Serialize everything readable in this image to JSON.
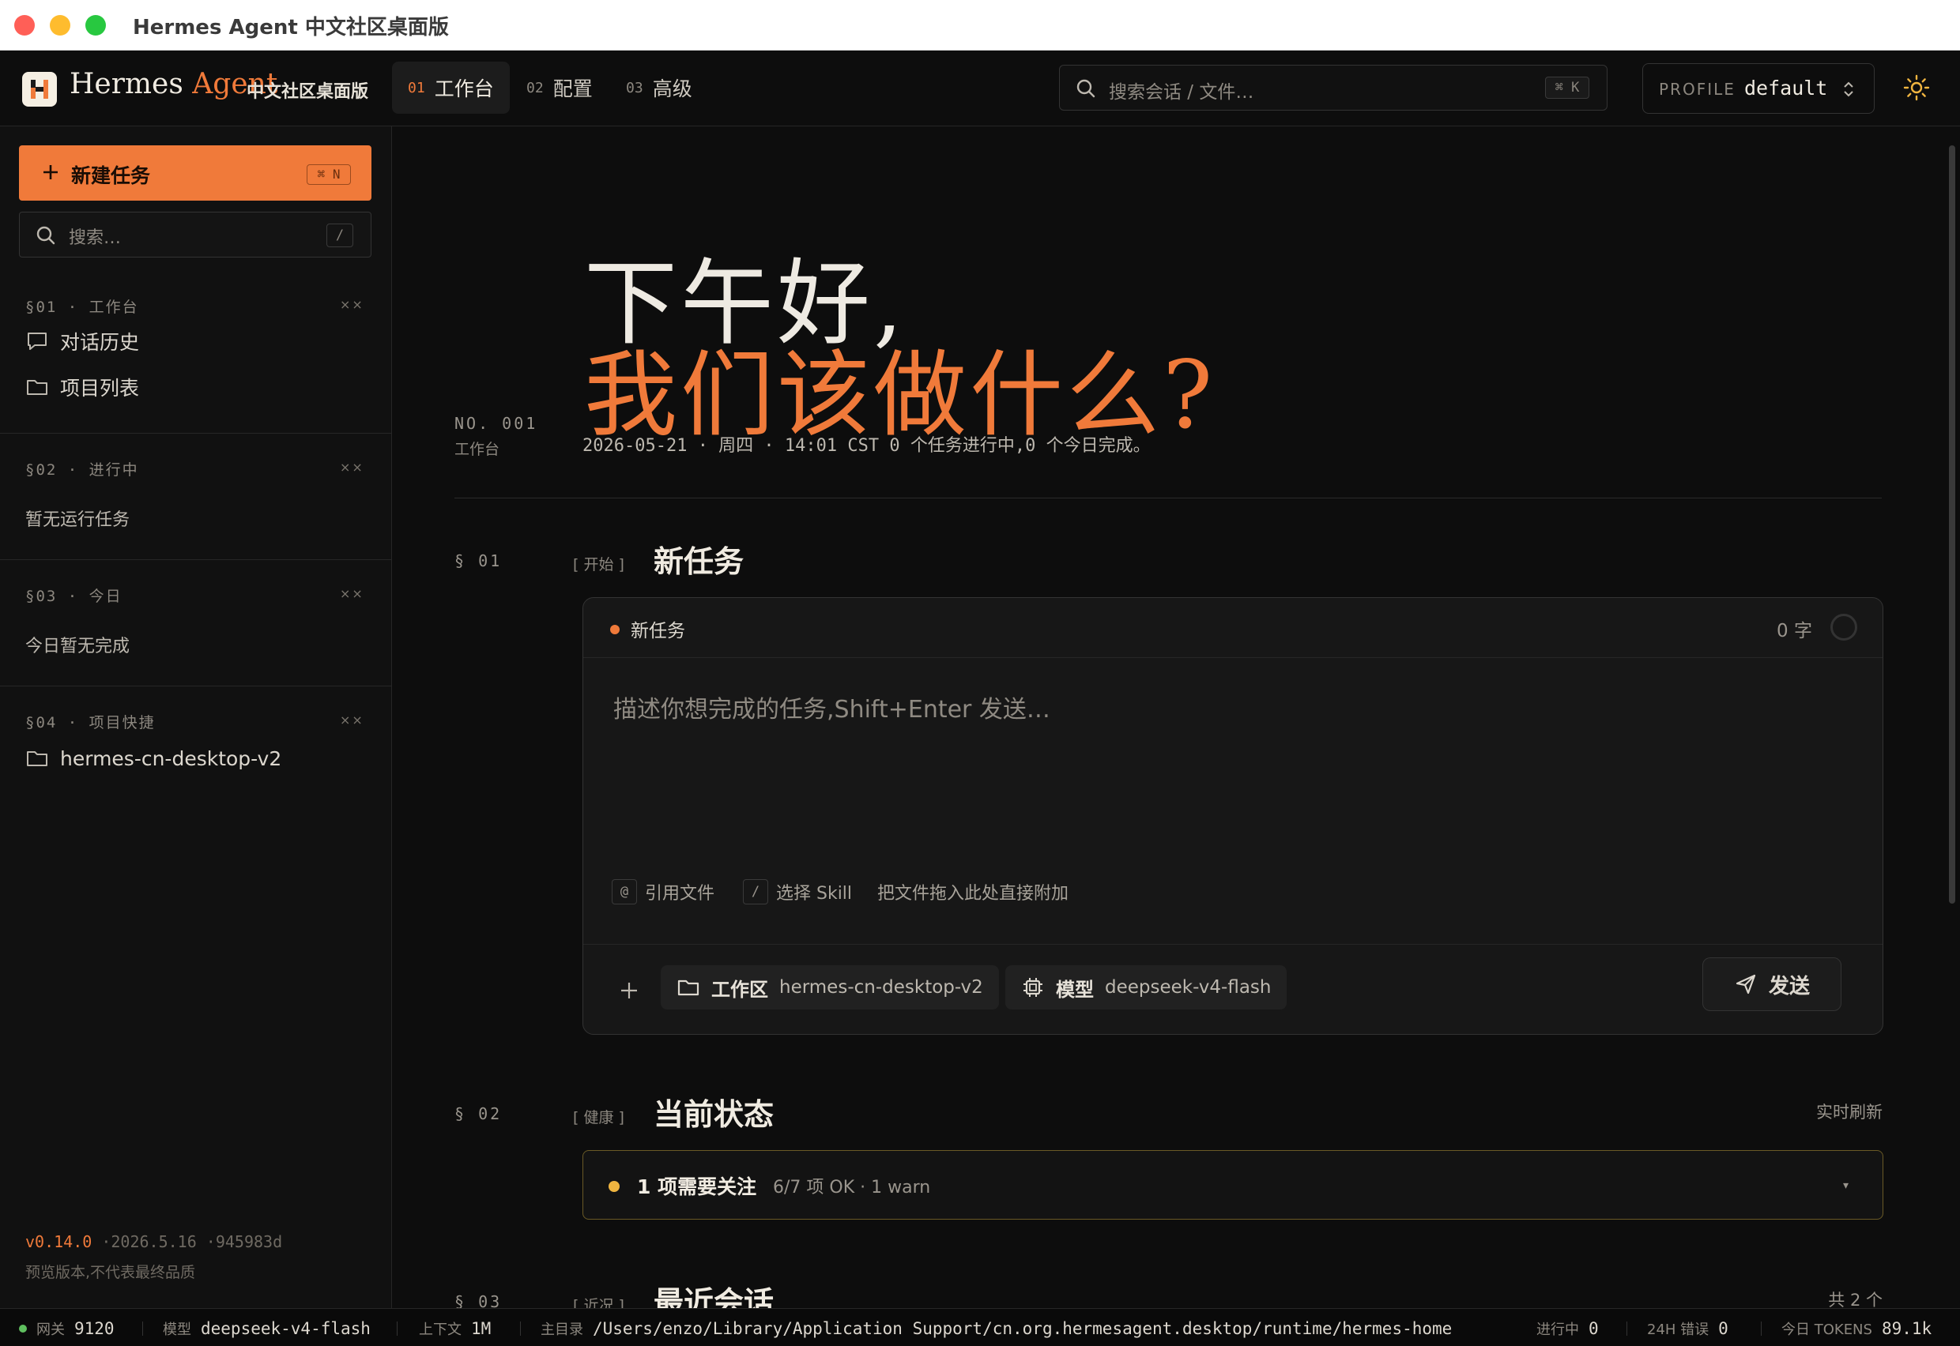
{
  "window": {
    "title": "Hermes Agent 中文社区桌面版"
  },
  "brand": {
    "name_a": "Hermes",
    "name_b": "Agent",
    "subtitle": "中文社区桌面版"
  },
  "nav": {
    "tabs": [
      {
        "num": "01",
        "label": "工作台",
        "active": true
      },
      {
        "num": "02",
        "label": "配置",
        "active": false
      },
      {
        "num": "03",
        "label": "高级",
        "active": false
      }
    ],
    "search_placeholder": "搜索会话 / 文件…",
    "search_shortcut": "⌘ K",
    "profile_key": "PROFILE",
    "profile_value": "default"
  },
  "sidebar": {
    "new_task_label": "新建任务",
    "new_task_shortcut": "⌘ N",
    "search_placeholder": "搜索…",
    "search_shortcut": "/",
    "collapse_mark": "××",
    "sections": [
      {
        "head": "§01 · 工作台",
        "items": [
          "对话历史",
          "项目列表"
        ]
      },
      {
        "head": "§02 · 进行中",
        "empty": "暂无运行任务"
      },
      {
        "head": "§03 · 今日",
        "empty": "今日暂无完成"
      },
      {
        "head": "§04 · 项目快捷",
        "items": [
          "hermes-cn-desktop-v2"
        ]
      }
    ],
    "version": "v0.14.0",
    "build": "·2026.5.16 ·945983d",
    "version_note": "预览版本,不代表最终品质"
  },
  "hero": {
    "greeting_line1": "下午好,",
    "greeting_line2": "我们该做什么?",
    "no_label": "NO. 001",
    "no_sub": "工作台",
    "meta": "2026-05-21 · 周四 · 14:01 CST   0 个任务进行中,0 个今日完成。"
  },
  "sections": {
    "s1": {
      "num": "§ 01",
      "tag": "[ 开始 ]",
      "title": "新任务"
    },
    "s2": {
      "num": "§ 02",
      "tag": "[ 健康 ]",
      "title": "当前状态",
      "right": "实时刷新"
    },
    "s3": {
      "num": "§ 03",
      "tag": "[ 近况 ]",
      "title": "最近会话",
      "right": "共 2 个"
    }
  },
  "composer": {
    "title": "新任务",
    "char_count": "0 字",
    "placeholder": "描述你想完成的任务,Shift+Enter 发送…",
    "hint_at_key": "@",
    "hint_at_label": "引用文件",
    "hint_slash_key": "/",
    "hint_slash_label": "选择 Skill",
    "hint_drop": "把文件拖入此处直接附加",
    "workspace_key": "工作区",
    "workspace_value": "hermes-cn-desktop-v2",
    "model_key": "模型",
    "model_value": "deepseek-v4-flash",
    "send_label": "发送"
  },
  "status": {
    "headline": "1 项需要关注",
    "detail": "6/7 项 OK · 1 warn",
    "caret": "▾"
  },
  "footer": {
    "gateway_k": "网关",
    "gateway_v": "9120",
    "model_k": "模型",
    "model_v": "deepseek-v4-flash",
    "context_k": "上下文",
    "context_v": "1M",
    "home_k": "主目录",
    "home_v": "/Users/enzo/Library/Application Support/cn.org.hermesagent.desktop/runtime/hermes-home",
    "running_k": "进行中",
    "running_v": "0",
    "errors_k": "24H 错误",
    "errors_v": "0",
    "tokens_k": "今日 TOKENS",
    "tokens_v": "89.1k"
  },
  "colors": {
    "accent": "#f07a3a",
    "warn": "#f0b540",
    "ok": "#5fbf5f",
    "bg": "#0d0d0d"
  }
}
